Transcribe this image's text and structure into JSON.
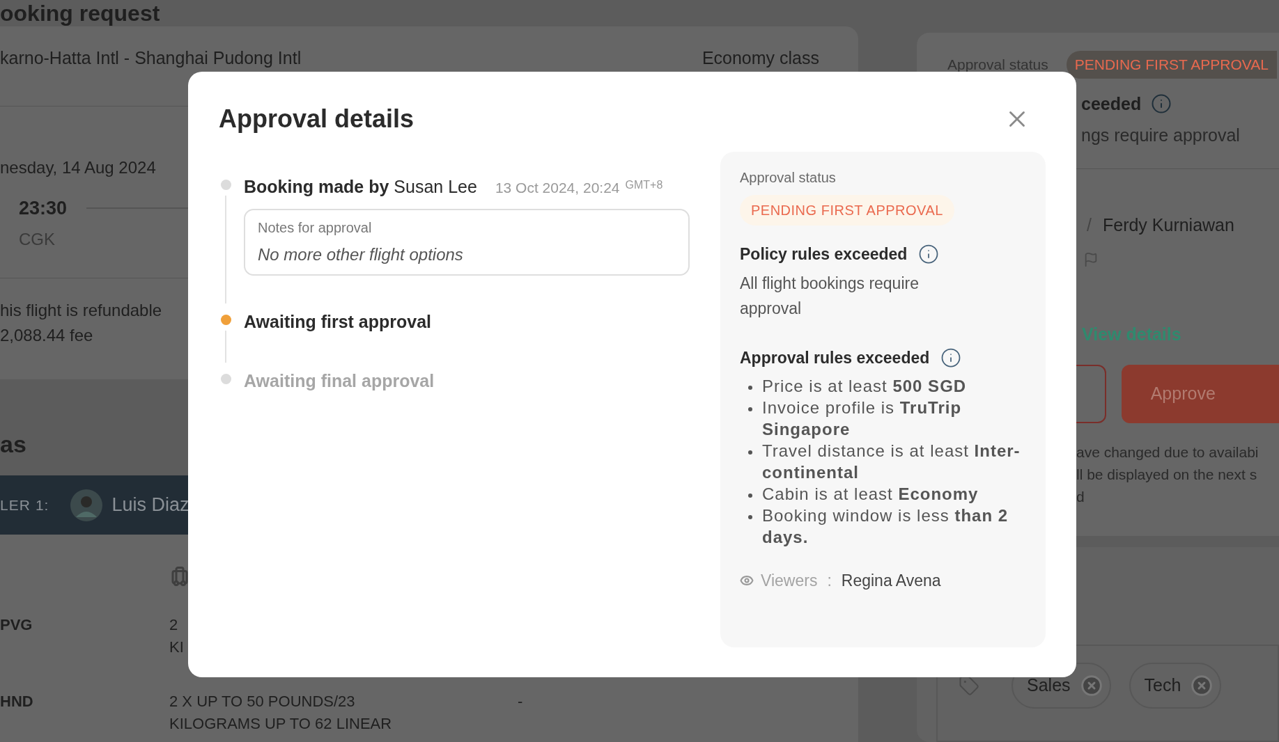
{
  "background": {
    "page_title": "ooking request",
    "flight": {
      "route": "karno-Hatta Intl - Shanghai Pudong Intl",
      "cabin": "Economy class",
      "date": "nesday, 14 Aug 2024",
      "departure_time": "23:30",
      "departure_airport": "CGK",
      "refund_lines": [
        "his flight is refundable",
        "2,088.44 fee"
      ]
    },
    "section_title": "as",
    "traveler": {
      "label": "LER 1:",
      "name": "Luis Diaz"
    },
    "baggage_rows": [
      {
        "airport": "PVG",
        "lines": [
          "2",
          "KI"
        ]
      },
      {
        "airport": "HND",
        "lines": [
          "2 X UP TO 50 POUNDS/23",
          "KILOGRAMS UP TO 62 LINEAR"
        ],
        "column_3": "-"
      }
    ],
    "approval_panel": {
      "status_label": "Approval status",
      "status": "PENDING FIRST APPROVAL",
      "rule_title": "ceeded",
      "rule_text": "ngs require approval",
      "separator": "/",
      "approver": "Ferdy Kurniawan",
      "link": "View details",
      "approve_button": "Approve",
      "note_lines": [
        "ave changed due to availabi",
        "ll be displayed on the next s",
        "d"
      ]
    },
    "tags": [
      {
        "label": "Sales"
      },
      {
        "label": "Tech"
      }
    ]
  },
  "modal": {
    "title": "Approval details",
    "timeline": [
      {
        "kind": "done",
        "title": "**Booking made by** Susan Lee",
        "time": "13 Oct 2024, 20:24",
        "timezone": "GMT+8",
        "note": {
          "label": "Notes for approval",
          "text": "No more other flight options"
        }
      },
      {
        "kind": "current",
        "title": "Awaiting first approval"
      },
      {
        "kind": "pending",
        "title": "Awaiting final approval"
      }
    ],
    "panel": {
      "status_label": "Approval status",
      "status": "PENDING FIRST APPROVAL",
      "sections": [
        {
          "title": "Policy rules exceeded",
          "text": "All flight bookings require approval"
        },
        {
          "title": "Approval rules exceeded",
          "bullets": [
            "Price is at least **500 SGD**",
            "Invoice profile is **TruTrip Singapore**",
            "Travel distance is at least **Inter-continental**",
            "Cabin is at least **Economy**",
            "Booking window is less **than 2 days.**"
          ]
        }
      ],
      "viewers_label": "Viewers",
      "viewers_separator": ":",
      "viewers": "Regina Avena"
    }
  }
}
